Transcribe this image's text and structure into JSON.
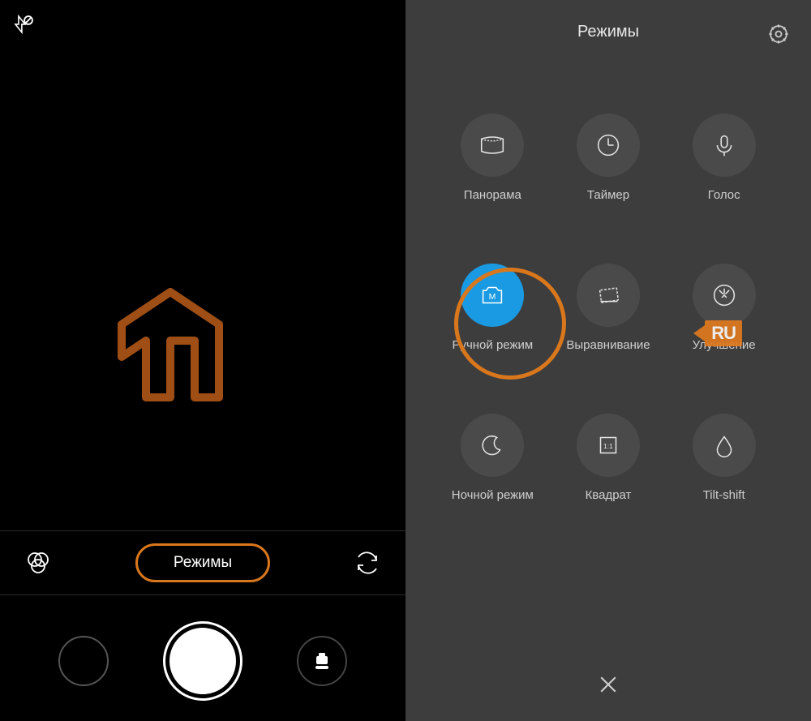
{
  "left": {
    "modes_label": "Режимы"
  },
  "right": {
    "title": "Режимы",
    "modes": [
      {
        "label": "Панорама"
      },
      {
        "label": "Таймер"
      },
      {
        "label": "Голос"
      },
      {
        "label": "Ручной режим"
      },
      {
        "label": "Выравнивание"
      },
      {
        "label": "Улучшение"
      },
      {
        "label": "Ночной режим"
      },
      {
        "label": "Квадрат"
      },
      {
        "label": "Tilt-shift"
      }
    ],
    "watermark_suffix": "RU"
  }
}
